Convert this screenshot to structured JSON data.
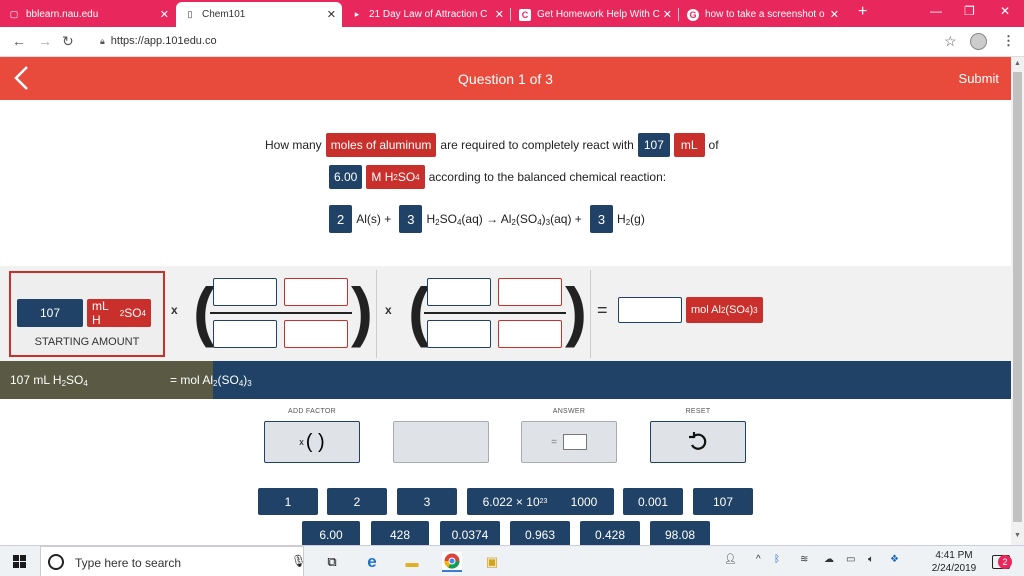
{
  "browser": {
    "tabs": [
      {
        "title": "bblearn.nau.edu",
        "icon": "page-icon"
      },
      {
        "title": "Chem101",
        "icon": "page-icon"
      },
      {
        "title": "21 Day Law of Attraction C",
        "icon": "youtube-icon"
      },
      {
        "title": "Get Homework Help With C",
        "icon": "chegg-icon"
      },
      {
        "title": "how to take a screenshot o",
        "icon": "google-icon"
      }
    ],
    "url": "https://app.101edu.co"
  },
  "header": {
    "question_label": "Question 1 of 3",
    "submit_label": "Submit",
    "color": "#e84a3c"
  },
  "question": {
    "line1_pre": "How many",
    "line1_chip": "moles of aluminum",
    "line1_mid": "are required to completely react with",
    "line1_val": "107",
    "line1_unit": "mL",
    "line1_post": "of",
    "line2_val": "6.00",
    "line2_unit_pre": "M H",
    "line2_unit_sub1": "2",
    "line2_unit_mid": "SO",
    "line2_unit_sub2": "4",
    "line2_post": "according to the balanced chemical reaction:",
    "reaction": {
      "coef1": "2",
      "sp1": "Al(s) +",
      "coef2": "3",
      "sp2a": "H",
      "sp2s1": "2",
      "sp2b": "SO",
      "sp2s2": "4",
      "sp2c": "(aq) → Al",
      "sp2s3": "2",
      "sp2d": "(SO",
      "sp2s4": "4",
      "sp2e": ")",
      "sp2s5": "3",
      "sp2f": "(aq) +",
      "coef3": "3",
      "sp3a": "H",
      "sp3s": "2",
      "sp3b": "(g)"
    }
  },
  "workspace": {
    "start_value": "107",
    "start_unit_a": "mL H",
    "start_unit_s1": "2",
    "start_unit_b": "SO",
    "start_unit_s2": "4",
    "start_label": "STARTING AMOUNT",
    "times": "x",
    "equals": "=",
    "result_unit_a": "mol Al",
    "result_unit_s1": "2",
    "result_unit_b": "(SO",
    "result_unit_s2": "4",
    "result_unit_c": ")",
    "result_unit_s3": "3"
  },
  "summary": {
    "start_a": "107 mL H",
    "start_s1": "2",
    "start_b": "SO",
    "start_s2": "4",
    "result_a": "= mol Al",
    "result_s1": "2",
    "result_b": "(SO",
    "result_s2": "4",
    "result_c": ")",
    "result_s3": "3"
  },
  "controls": {
    "add_factor_label": "ADD FACTOR",
    "add_factor_symbol": "( )",
    "add_factor_x": "x",
    "answer_label": "ANSWER",
    "answer_eq": "=",
    "reset_label": "RESET"
  },
  "numpad": {
    "row1": [
      "1",
      "2",
      "3",
      "6.022 × 10",
      "1000",
      "0.001",
      "107"
    ],
    "avogadro_exp": "23",
    "row2": [
      "6.00",
      "428",
      "0.0374",
      "0.963",
      "0.428",
      "98.08"
    ]
  },
  "taskbar": {
    "search_placeholder": "Type here to search",
    "time": "4:41 PM",
    "date": "2/24/2019",
    "notification_count": "2"
  }
}
